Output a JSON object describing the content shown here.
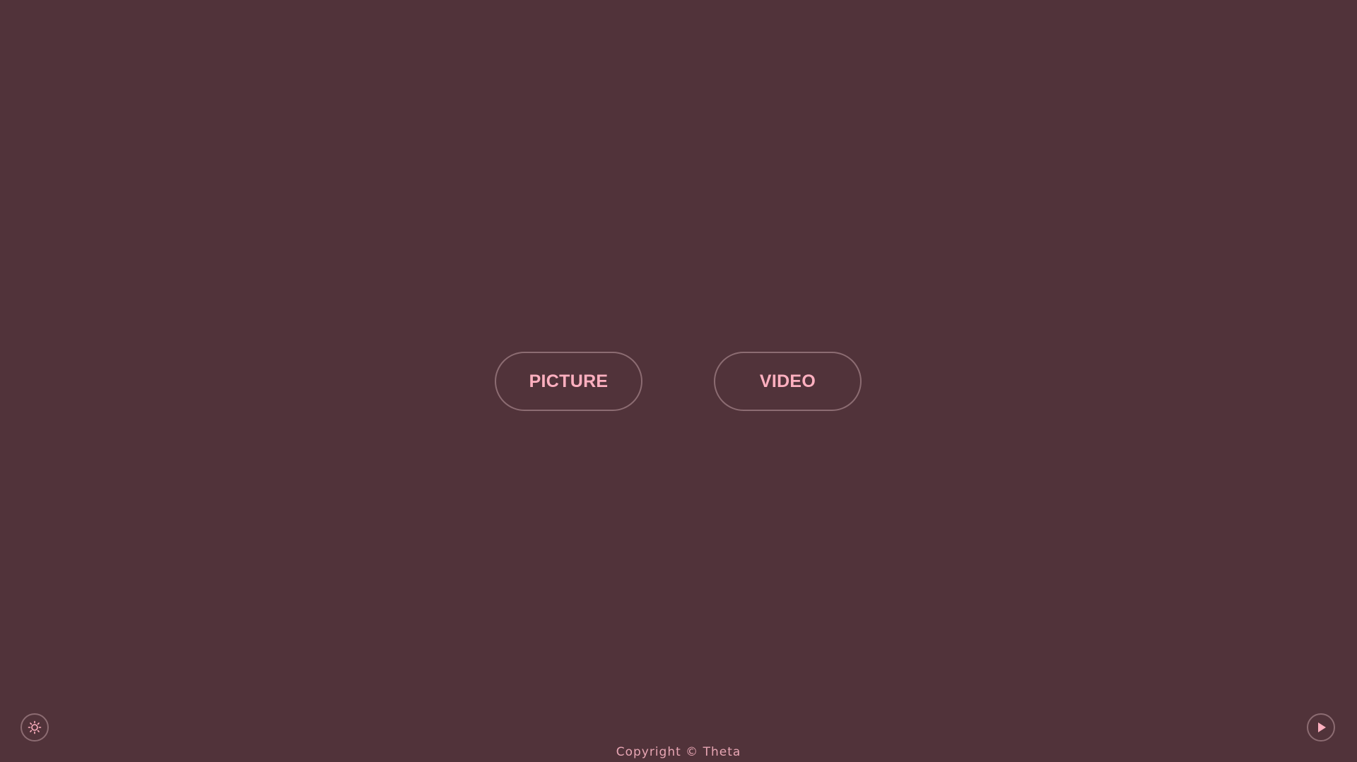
{
  "main": {
    "buttons": {
      "picture_label": "PICTURE",
      "video_label": "VIDEO"
    }
  },
  "controls": {
    "theme_icon": "sun-icon",
    "play_icon": "play-icon"
  },
  "footer": {
    "copyright": "Copyright © Theta"
  },
  "colors": {
    "background": "#51333a",
    "accent": "#ffb0c0",
    "border": "#8c6c72"
  }
}
